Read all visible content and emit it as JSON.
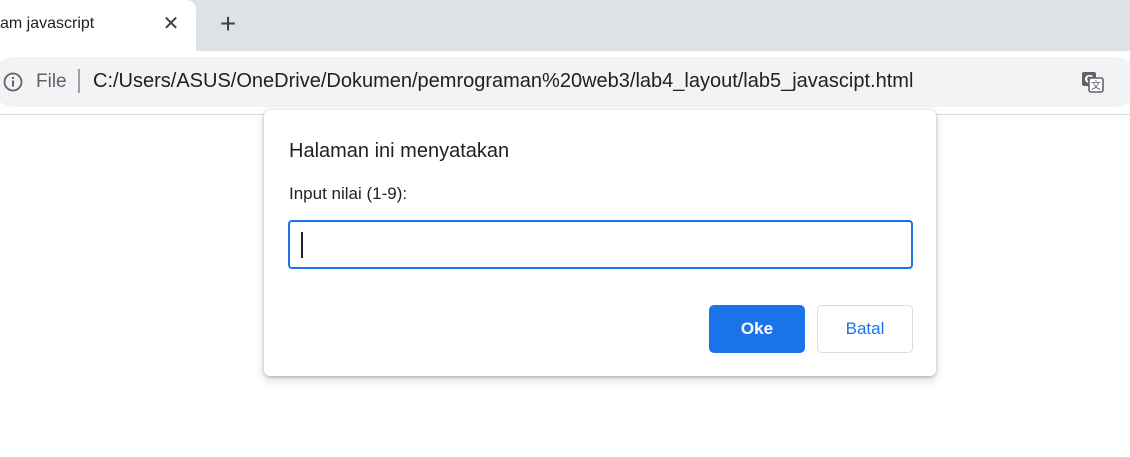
{
  "tab": {
    "title": "am javascript",
    "close_glyph": "✕",
    "new_tab_glyph": "+"
  },
  "omnibox": {
    "scheme": "File",
    "url": "C:/Users/ASUS/OneDrive/Dokumen/pemrograman%20web3/lab4_layout/lab5_javascipt.html"
  },
  "dialog": {
    "title": "Halaman ini menyatakan",
    "message": "Input nilai (1-9):",
    "input_value": "",
    "ok_label": "Oke",
    "cancel_label": "Batal"
  },
  "colors": {
    "accent": "#1a73e8",
    "tabstrip": "#dee1e6",
    "omnibox": "#f1f3f4"
  }
}
